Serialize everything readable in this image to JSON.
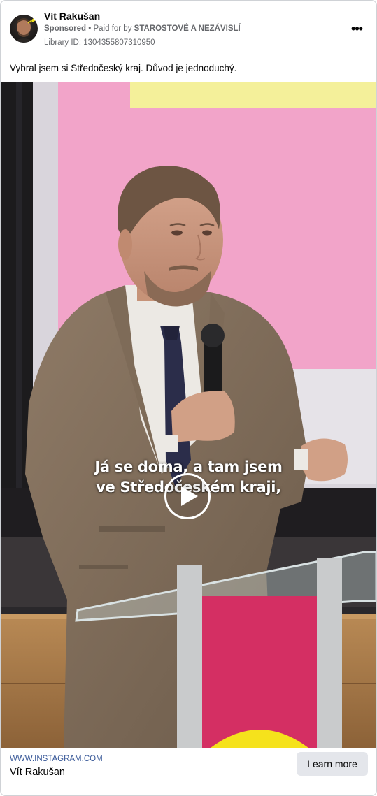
{
  "post": {
    "page_name": "Vít Rakušan",
    "sponsored_label": "Sponsored",
    "separator": " • ",
    "paid_for_prefix": "Paid for by ",
    "paid_for_by": "STAROSTOVÉ A NEZÁVISLÍ",
    "library_id": "Library ID: 1304355807310950",
    "more_menu_icon": "more-options-icon",
    "more_label": "•••",
    "caption": "Vybral jsem si Středočeský kraj. Důvod je jednoduchý."
  },
  "media": {
    "subtitle_line1": "Já se doma, a tam jsem",
    "subtitle_line2": "ve Středočeském kraji,",
    "play_icon": "play-icon"
  },
  "footer": {
    "link_url": "WWW.INSTAGRAM.COM",
    "link_title": "Vít Rakušan",
    "cta_label": "Learn more"
  },
  "colors": {
    "secondary_text": "#65676b",
    "link": "#385898",
    "cta_bg": "#e4e6eb",
    "screen_pink": "#f2a4c9",
    "screen_yellow": "#f4f09a",
    "podium_pink": "#d42f63",
    "podium_yellow": "#f5e21c"
  }
}
